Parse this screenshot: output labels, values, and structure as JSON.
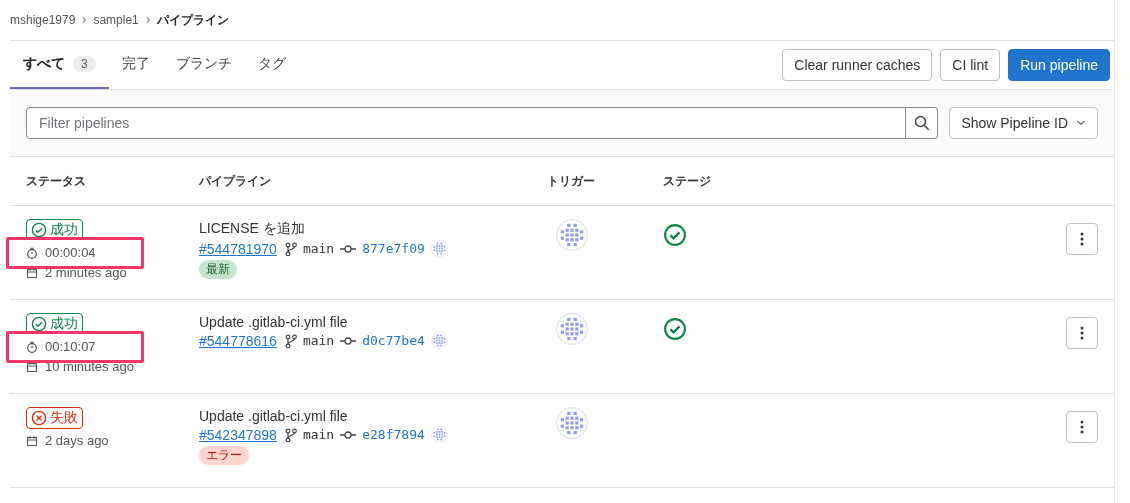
{
  "breadcrumb": [
    {
      "label": "mshige1979"
    },
    {
      "label": "sample1"
    },
    {
      "label": "パイプライン"
    }
  ],
  "tabs": [
    {
      "label": "すべて",
      "count": "3",
      "selected": true
    },
    {
      "label": "完了",
      "selected": false
    },
    {
      "label": "ブランチ",
      "selected": false
    },
    {
      "label": "タグ",
      "selected": false
    }
  ],
  "buttons": [
    {
      "label": "Clear runner caches",
      "kind": "default"
    },
    {
      "label": "CI lint",
      "kind": "default"
    },
    {
      "label": "Run pipeline",
      "kind": "primary"
    }
  ],
  "filter": {
    "placeholder": "Filter pipelines"
  },
  "display_dropdown": {
    "label": "Show Pipeline ID"
  },
  "table": {
    "columns": [
      "ステータス",
      "パイプライン",
      "トリガー",
      "ステージ"
    ],
    "rows": [
      {
        "status": {
          "label": "成功",
          "kind": "success"
        },
        "duration": {
          "text": "00:00:04",
          "highlighted": true
        },
        "created": "2 minutes ago",
        "title": "LICENSE を追加",
        "id": "#544781970",
        "branch": "main",
        "commit": "877e7f09",
        "badge": {
          "label": "最新",
          "kind": "latest"
        },
        "stages": [
          {
            "kind": "success"
          }
        ]
      },
      {
        "status": {
          "label": "成功",
          "kind": "success"
        },
        "duration": {
          "text": "00:10:07",
          "highlighted": true
        },
        "created": "10 minutes ago",
        "title": "Update .gitlab-ci.yml file",
        "id": "#544778616",
        "branch": "main",
        "commit": "d0c77be4",
        "stages": [
          {
            "kind": "success"
          }
        ]
      },
      {
        "status": {
          "label": "失敗",
          "kind": "failed"
        },
        "created": "2 days ago",
        "title": "Update .gitlab-ci.yml file",
        "id": "#542347898",
        "branch": "main",
        "commit": "e28f7894",
        "badge": {
          "label": "エラー",
          "kind": "error"
        }
      }
    ]
  }
}
